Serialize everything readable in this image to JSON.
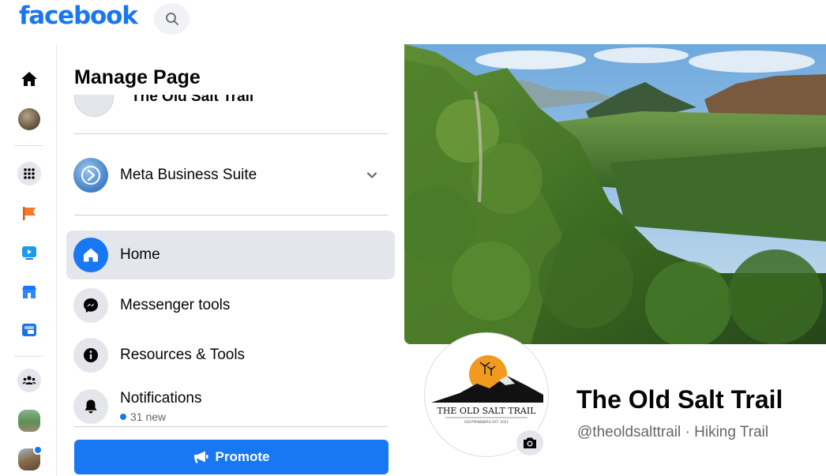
{
  "topbar": {
    "logo_text": "facebook",
    "search_icon": "search-icon"
  },
  "rail": {
    "items": [
      {
        "name": "home-icon"
      },
      {
        "name": "profile-avatar"
      },
      {
        "name": "menu-grid-icon"
      },
      {
        "name": "flag-pages-icon"
      },
      {
        "name": "watch-icon"
      },
      {
        "name": "marketplace-icon"
      },
      {
        "name": "gaming-icon"
      },
      {
        "name": "groups-icon"
      },
      {
        "name": "group-avatar"
      },
      {
        "name": "group-avatar-2"
      }
    ]
  },
  "panel": {
    "title": "Manage Page",
    "page_name_partial": "The Old Salt Trail",
    "business_suite_label": "Meta Business Suite",
    "menu": [
      {
        "label": "Home",
        "icon": "home-icon",
        "active": true
      },
      {
        "label": "Messenger tools",
        "icon": "messenger-icon"
      },
      {
        "label": "Resources & Tools",
        "icon": "info-icon"
      },
      {
        "label": "Notifications",
        "icon": "bell-icon",
        "sub": "31 new"
      }
    ],
    "promote_label": "Promote"
  },
  "profile": {
    "name": "The Old Salt Trail",
    "handle_category": "@theoldsalttrail · Hiking Trail",
    "logo_text": "THE OLD SALT TRAIL",
    "logo_subtext": "SOUTPANSBERG EST. 2021"
  },
  "colors": {
    "brand": "#1877f2",
    "active_row": "#e4e6eb",
    "secondary_text": "#65676b"
  }
}
